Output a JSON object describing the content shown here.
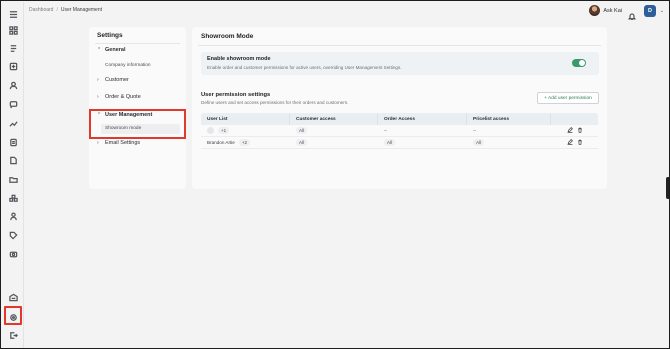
{
  "breadcrumb": {
    "root": "Dashboard",
    "separator": "/",
    "current": "User Management"
  },
  "user": {
    "name": "Ask Kai",
    "org_initial": "D"
  },
  "settings": {
    "title": "Settings",
    "groups": [
      {
        "label": "General",
        "expanded": true,
        "items": [
          "Company information"
        ]
      },
      {
        "label": "Customer",
        "expanded": false
      },
      {
        "label": "Order & Quote",
        "expanded": false
      },
      {
        "label": "User Management",
        "expanded": true,
        "items": [
          "Showroom mode"
        ]
      },
      {
        "label": "Email Settings",
        "expanded": false
      }
    ]
  },
  "main": {
    "title": "Showroom Mode",
    "showroom": {
      "heading": "Enable showroom mode",
      "description": "Enable order and customer permissions for active users, overriding User Management Settings.",
      "enabled": true
    },
    "permissions": {
      "heading": "User permission settings",
      "description": "Define users and set access permissions for their orders and customers.",
      "add_button": "+ Add user permission",
      "columns": [
        "User List",
        "Customer access",
        "Order Access",
        "Pricelist access"
      ],
      "rows": [
        {
          "user": "",
          "extra": "+1",
          "customer": "All",
          "order": "--",
          "pricelist": "--"
        },
        {
          "user": "Brandon Artie",
          "extra": "+2",
          "customer": "All",
          "order": "All",
          "pricelist": "All"
        }
      ]
    }
  },
  "colors": {
    "accent": "#3b9a6b",
    "highlight": "#e0392b",
    "org_badge": "#2f5f9a"
  },
  "rail_icons": [
    "menu-icon",
    "dashboard-icon",
    "orders-icon",
    "catalog-icon",
    "customers-icon",
    "messages-icon",
    "analytics-icon",
    "reports-icon",
    "documents-icon",
    "folder-icon",
    "integrations-icon",
    "team-icon",
    "tags-icon",
    "media-icon",
    "warehouse-icon",
    "settings-icon",
    "logout-icon"
  ]
}
